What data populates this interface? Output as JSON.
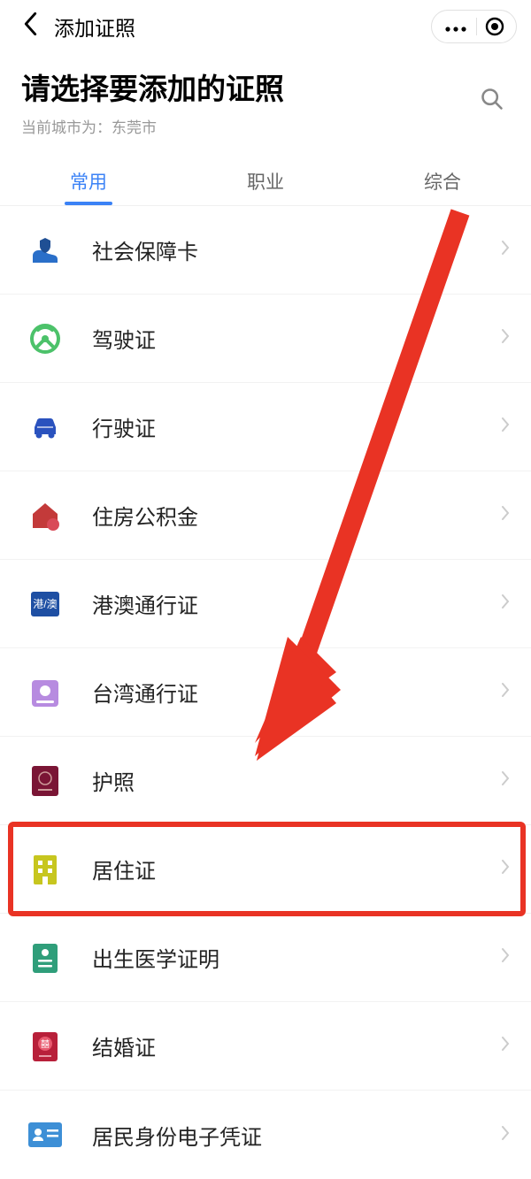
{
  "navbar": {
    "title": "添加证照"
  },
  "header": {
    "title": "请选择要添加的证照",
    "city_prefix": "当前城市为：",
    "city": "东莞市"
  },
  "tabs": [
    {
      "label": "常用",
      "active": true
    },
    {
      "label": "职业",
      "active": false
    },
    {
      "label": "综合",
      "active": false
    }
  ],
  "items": [
    {
      "label": "社会保障卡",
      "icon": "social-security-card-icon"
    },
    {
      "label": "驾驶证",
      "icon": "drivers-license-icon"
    },
    {
      "label": "行驶证",
      "icon": "vehicle-license-icon"
    },
    {
      "label": "住房公积金",
      "icon": "housing-fund-icon"
    },
    {
      "label": "港澳通行证",
      "icon": "hk-macau-permit-icon"
    },
    {
      "label": "台湾通行证",
      "icon": "taiwan-permit-icon"
    },
    {
      "label": "护照",
      "icon": "passport-icon"
    },
    {
      "label": "居住证",
      "icon": "residence-permit-icon",
      "highlighted": true
    },
    {
      "label": "出生医学证明",
      "icon": "birth-certificate-icon"
    },
    {
      "label": "结婚证",
      "icon": "marriage-certificate-icon"
    },
    {
      "label": "居民身份电子凭证",
      "icon": "eid-card-icon"
    }
  ],
  "annotation": {
    "arrow_target_index": 7
  }
}
